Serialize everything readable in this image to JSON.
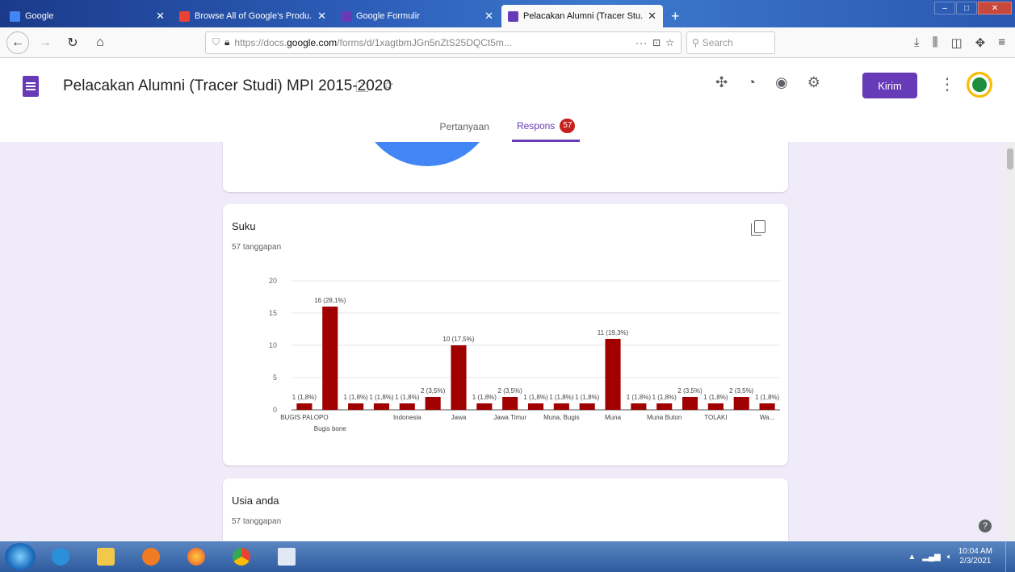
{
  "browser": {
    "tabs": [
      {
        "title": "Google",
        "favicon_color": "#4285f4",
        "active": false,
        "width": 208
      },
      {
        "title": "Browse All of Google's Produ...",
        "favicon_color": "#ea4335",
        "active": false,
        "width": 198
      },
      {
        "title": "Google Formulir",
        "favicon_color": "#673ab7",
        "active": false,
        "width": 205
      },
      {
        "title": "Pelacakan Alumni (Tracer Stu...",
        "favicon_color": "#673ab7",
        "active": true,
        "width": 200
      }
    ],
    "url_prefix": "https://docs.",
    "url_domain": "google.com",
    "url_rest": "/forms/d/1xagtbmJGn5nZtS25DQCt5m...",
    "url_more": "···",
    "search_placeholder": "Search"
  },
  "form": {
    "title": "Pelacakan Alumni (Tracer Studi) MPI 2015-2020",
    "send_label": "Kirim",
    "tab_questions": "Pertanyaan",
    "tab_responses": "Respons",
    "responses_count": "57"
  },
  "questions": [
    {
      "title": "Suku",
      "count_label": "57 tanggapan"
    },
    {
      "title": "Usia anda",
      "count_label": "57 tanggapan"
    }
  ],
  "chart_data": {
    "type": "bar",
    "title": "Suku",
    "ylim": [
      0,
      20
    ],
    "yticks": [
      0,
      5,
      10,
      15,
      20
    ],
    "bar_color": "#a00000",
    "grid": true,
    "categories": [
      "BUGIS PALOPO",
      "Bugis bone",
      "",
      "",
      "Indonesia",
      "",
      "Jawa",
      "",
      "Jawa Timur",
      "",
      "Muna, Bugis",
      "",
      "Muna",
      "",
      "Muna Buton",
      "",
      "TOLAKI",
      "",
      "Wa..."
    ],
    "values": [
      1,
      16,
      1,
      1,
      1,
      2,
      10,
      1,
      2,
      1,
      1,
      1,
      11,
      1,
      1,
      2,
      1,
      2,
      1
    ],
    "data_labels": [
      "1 (1,8%)",
      "16 (28,1%)",
      "1 (1,8%)",
      "1 (1,8%)",
      "1 (1,8%)",
      "2 (3,5%)",
      "10 (17,5%)",
      "1 (1,8%)",
      "2 (3,5%)",
      "1 (1,8%)",
      "1 (1,8%)",
      "1 (1,8%)",
      "11 (19,3%)",
      "1 (1,8%)",
      "1 (1,8%)",
      "2 (3,5%)",
      "1 (1,8%)",
      "2 (3,5%)",
      "1 (1,8%)"
    ]
  },
  "taskbar": {
    "time": "10:04 AM",
    "date": "2/3/2021"
  }
}
